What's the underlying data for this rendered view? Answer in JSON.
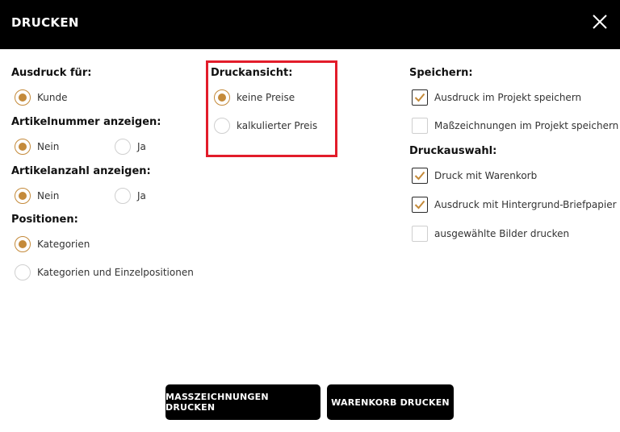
{
  "dialog": {
    "title": "DRUCKEN"
  },
  "left": {
    "ausdruck_fuer": {
      "label": "Ausdruck für:",
      "options": [
        "Kunde"
      ]
    },
    "artikelnummer": {
      "label": "Artikelnummer anzeigen:",
      "options": [
        "Nein",
        "Ja"
      ]
    },
    "artikelanzahl": {
      "label": "Artikelanzahl anzeigen:",
      "options": [
        "Nein",
        "Ja"
      ]
    },
    "positionen": {
      "label": "Positionen:",
      "options": [
        "Kategorien",
        "Kategorien und Einzelpositionen"
      ]
    }
  },
  "middle": {
    "druckansicht": {
      "label": "Druckansicht:",
      "options": [
        "keine Preise",
        "kalkulierter Preis"
      ]
    }
  },
  "right": {
    "speichern": {
      "label": "Speichern:",
      "options": [
        "Ausdruck im Projekt speichern",
        "Maßzeichnungen im Projekt speichern"
      ]
    },
    "druckauswahl": {
      "label": "Druckauswahl:",
      "options": [
        "Druck mit Warenkorb",
        "Ausdruck mit Hintergrund-Briefpapier",
        "ausgewählte Bilder drucken"
      ]
    }
  },
  "buttons": {
    "massz": "MASSZEICHNUNGEN DRUCKEN",
    "warenkorb": "WARENKORB DRUCKEN"
  },
  "colors": {
    "accent": "#c48a3a",
    "highlight": "#e21c2a",
    "header": "#000000"
  }
}
